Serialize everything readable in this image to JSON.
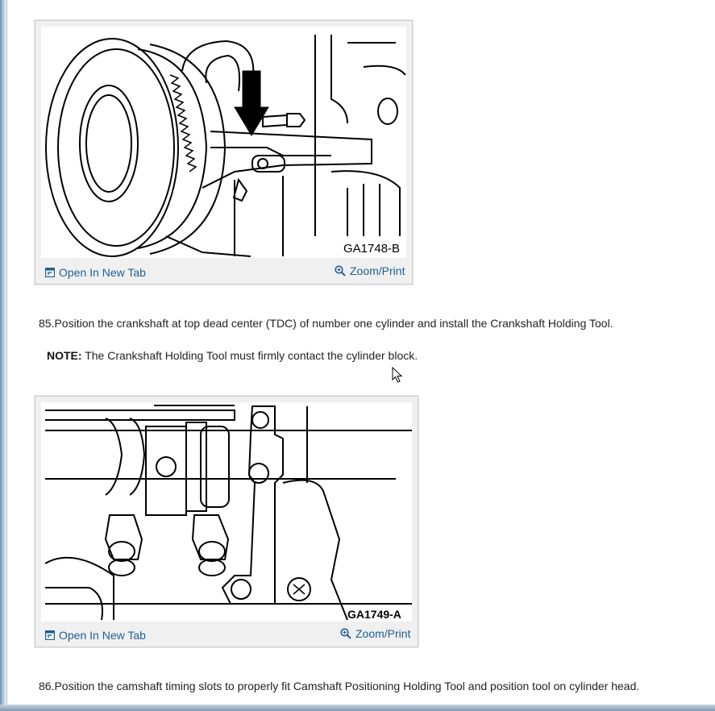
{
  "figures": [
    {
      "caption": "GA1748-B",
      "open_label": "Open In New Tab",
      "zoom_label": "Zoom/Print"
    },
    {
      "caption": "GA1749-A",
      "open_label": "Open In New Tab",
      "zoom_label": "Zoom/Print"
    }
  ],
  "steps": {
    "step85": "85.Position the crankshaft at top dead center (TDC) of number one cylinder and install the Crankshaft Holding Tool.",
    "note_label": "NOTE:",
    "note_text": " The Crankshaft Holding Tool must firmly contact the cylinder block.",
    "step86": "86.Position the camshaft timing slots to properly fit Camshaft Positioning Holding Tool and position tool on cylinder head."
  },
  "colors": {
    "link": "#1f5f93",
    "frame": "#f0f0f0"
  },
  "icons": {
    "open": "open-new-tab-icon",
    "zoom": "zoom-magnifier-icon",
    "cursor": "mouse-pointer-icon"
  }
}
